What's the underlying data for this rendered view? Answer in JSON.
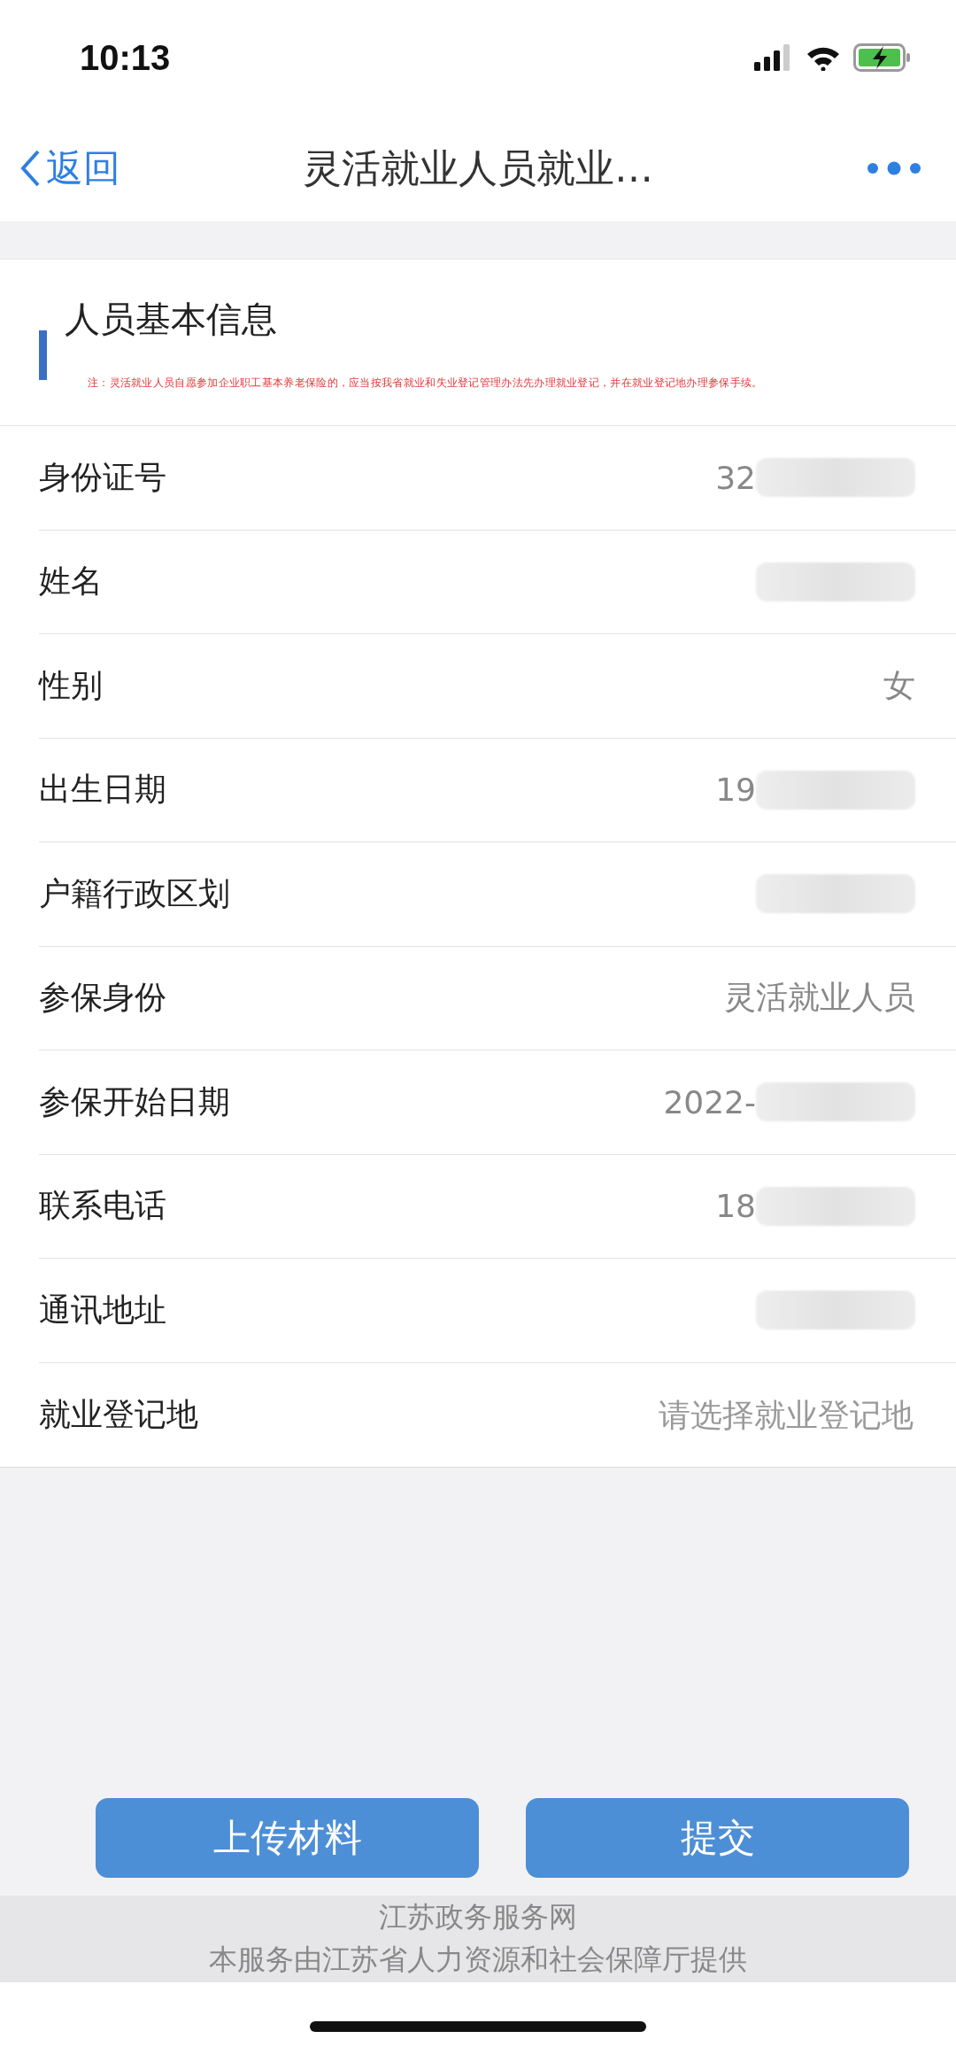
{
  "status_bar": {
    "time": "10:13"
  },
  "nav": {
    "back": "返回",
    "title": "灵活就业人员就业…"
  },
  "section": {
    "title": "人员基本信息",
    "note": "注：灵活就业人员自愿参加企业职工基本养老保险的，应当按我省就业和失业登记管理办法先办理就业登记，并在就业登记地办理参保手续。"
  },
  "fields": [
    {
      "label": "身份证号",
      "value": "32",
      "redacted": true
    },
    {
      "label": "姓名",
      "redacted": true
    },
    {
      "label": "性别",
      "value": "女",
      "redacted": false
    },
    {
      "label": "出生日期",
      "value": "19",
      "redacted": true
    },
    {
      "label": "户籍行政区划",
      "redacted": true
    },
    {
      "label": "参保身份",
      "value": "灵活就业人员",
      "redacted": false
    },
    {
      "label": "参保开始日期",
      "value": "2022-",
      "redacted": true
    },
    {
      "label": "联系电话",
      "value": "18",
      "redacted": true
    },
    {
      "label": "通讯地址",
      "redacted": true
    },
    {
      "label": "就业登记地",
      "placeholder": "请选择就业登记地",
      "redacted": false
    }
  ],
  "buttons": [
    "上传材料",
    "提交"
  ],
  "footer": [
    "江苏政务服务网",
    "本服务由江苏省人力资源和社会保障厅提供"
  ]
}
